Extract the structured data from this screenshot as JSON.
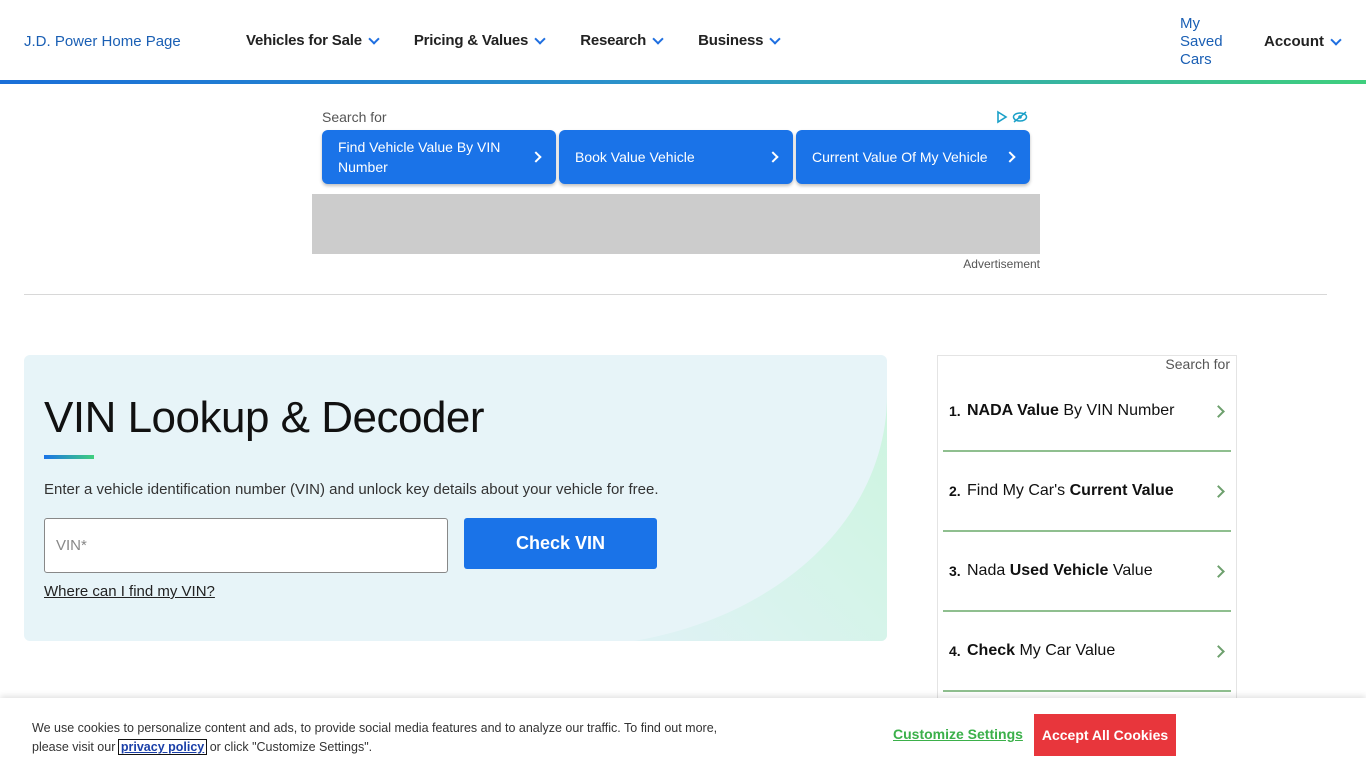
{
  "header": {
    "logo_alt": "J.D. Power Home Page",
    "nav": [
      {
        "label": "Vehicles for Sale"
      },
      {
        "label": "Pricing & Values"
      },
      {
        "label": "Research"
      },
      {
        "label": "Business"
      }
    ],
    "saved_cars": "My Saved Cars",
    "account": "Account"
  },
  "ad_top": {
    "search_for": "Search for",
    "buttons": [
      {
        "label": "Find Vehicle Value By VIN Number"
      },
      {
        "label": "Book Value Vehicle"
      },
      {
        "label": "Current Value Of My Vehicle"
      }
    ],
    "ad_label": "Advertisement"
  },
  "vin": {
    "title": "VIN Lookup & Decoder",
    "description": "Enter a vehicle identification number (VIN) and unlock key details about your vehicle for free.",
    "input_placeholder": "VIN*",
    "button": "Check VIN",
    "help_link": "Where can I find my VIN?"
  },
  "side_ad": {
    "search_for": "Search for",
    "items": [
      {
        "num": "1.",
        "bold": "NADA Value",
        "rest": " By VIN Number"
      },
      {
        "num": "2.",
        "pre": "Find My Car's ",
        "bold": "Current Value"
      },
      {
        "num": "3.",
        "pre": "Nada ",
        "bold": "Used Vehicle",
        "rest": " Value"
      },
      {
        "num": "4.",
        "bold": "Check",
        "rest": " My Car Value"
      }
    ]
  },
  "cookie": {
    "text_before": "We use cookies to personalize content and ads, to provide social media features and to analyze our traffic. To find out more, please visit our",
    "privacy_link": "privacy policy",
    "text_after": "or click \"Customize Settings\".",
    "customize": "Customize Settings",
    "accept": "Accept All Cookies"
  },
  "colors": {
    "primary": "#1a73e8",
    "accent_green": "#3fcf7d",
    "accept_red": "#e8363c"
  }
}
